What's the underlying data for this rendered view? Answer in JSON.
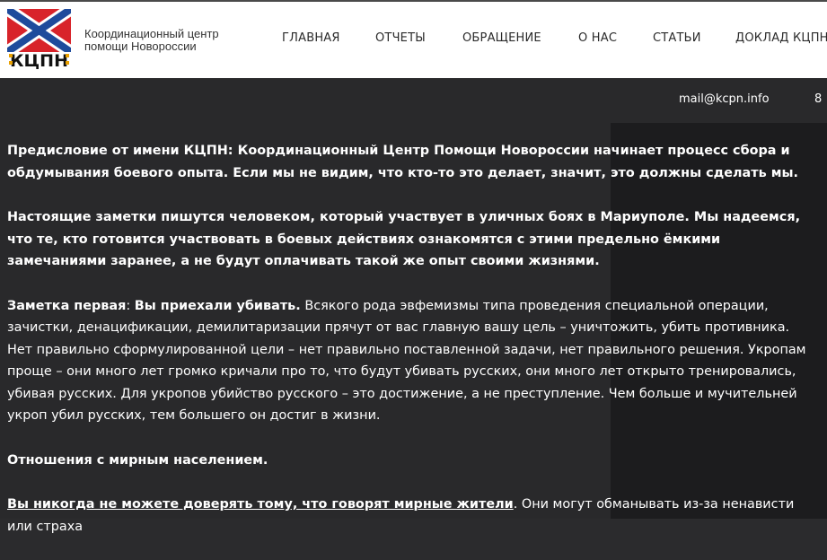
{
  "logo": {
    "text": "КЦПН"
  },
  "site": {
    "name": "Координационный центр помощи Новороссии"
  },
  "nav": [
    "ГЛАВНАЯ",
    "ОТЧЕТЫ",
    "ОБРАЩЕНИЕ",
    "О НАС",
    "СТАТЬИ",
    "ДОКЛАД КЦПН"
  ],
  "contact": {
    "email": "mail@kcpn.info",
    "phone_partial": "8"
  },
  "colors": {
    "flag_red": "#d8232a",
    "flag_blue": "#1e4b9c",
    "background": "#2b2b2d"
  },
  "article": {
    "p1": "Предисловие от имени КЦПН: Координационный Центр Помощи Новороссии начинает процесс сбора и обдумывания боевого опыта. Если  мы не видим, что кто-то это делает, значит, это должны сделать мы.",
    "p2": "Настоящие заметки пишутся человеком, который участвует в уличных боях в Мариуполе. Мы надеемся, что те, кто готовится участвовать в боевых действиях ознакомятся с этими предельно ёмкими замечаниями заранее, а не будут оплачивать такой же опыт своими жизнями.",
    "p3_label": "Заметка первая",
    "p3_sep": ": ",
    "p3_title": "Вы приехали убивать.",
    "p3_body": " Всякого рода эвфемизмы типа проведения специальной операции, зачистки, денацификации, демилитаризации прячут от вас главную вашу цель – уничтожить, убить противника. Нет правильно сформулированной цели – нет правильно поставленной задачи, нет правильного решения. Укропам проще – они много лет громко кричали про то, что будут убивать русских, они много лет открыто тренировались, убивая русских. Для укропов убийство русского – это достижение, а не преступление. Чем больше и мучительней укроп убил русских, тем большего он достиг в жизни.",
    "h2": "Отношения с мирным населением.",
    "p4_u": "Вы никогда не можете доверять тому, что говорят мирные жители",
    "p4_rest": ". Они могут обманывать из-за ненависти или страха"
  }
}
